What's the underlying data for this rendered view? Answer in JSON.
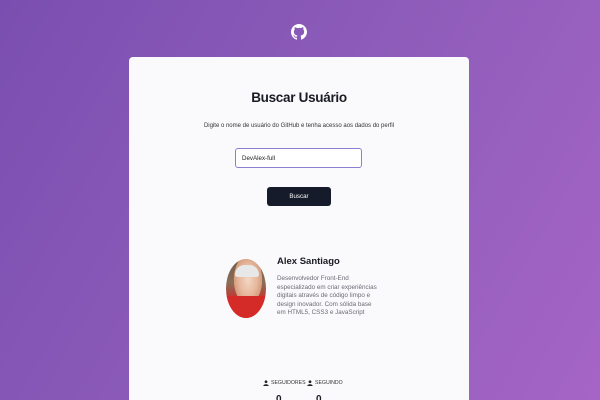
{
  "header": {
    "logo_icon": "github-icon"
  },
  "card": {
    "title": "Buscar Usuário",
    "subtitle": "Digite o nome de usuário do GitHub e tenha acesso aos dados do perfil",
    "search": {
      "value": "DevAlex-full"
    },
    "button_label": "Buscar"
  },
  "profile": {
    "name": "Alex Santiago",
    "bio": "Desenvolvedor Front-End especializado em criar experiências digitais através de código limpo e design inovador. Com sólida base em HTML5, CSS3 e JavaScript",
    "followers_label": "SEGUIDORES",
    "following_label": "SEGUINDO",
    "followers_count": "0",
    "following_count": "0"
  },
  "colors": {
    "background_start": "#7a4eb0",
    "background_end": "#a565c6",
    "button": "#151b2a",
    "input_border": "#8a7fd0"
  }
}
